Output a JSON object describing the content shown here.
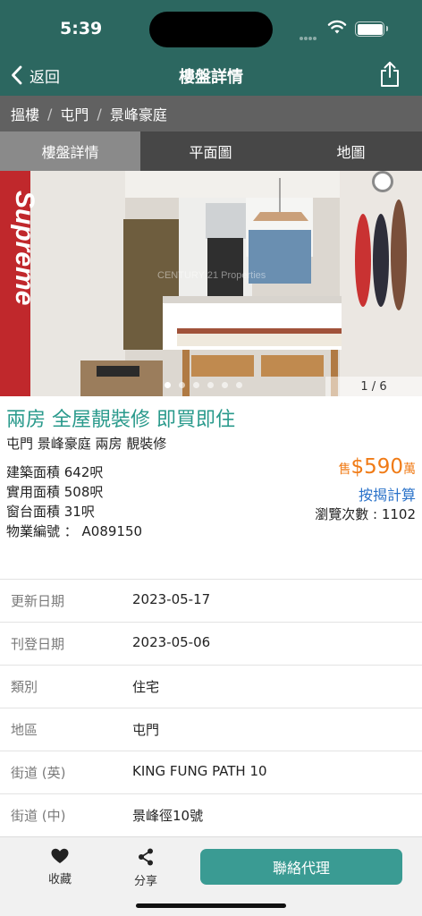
{
  "status_bar": {
    "time": "5:39"
  },
  "nav": {
    "back_label": "返回",
    "title": "樓盤詳情"
  },
  "breadcrumb": [
    "搵樓",
    "屯門",
    "景峰豪庭"
  ],
  "tabs": [
    "樓盤詳情",
    "平面圖",
    "地圖"
  ],
  "gallery": {
    "counter": "1 / 6",
    "banner_text": "Supreme",
    "watermark": "CENTURY 21 Properties",
    "current_index": 1,
    "total": 6
  },
  "listing": {
    "headline": "兩房 全屋靚裝修 即買即住",
    "subline": "屯門  景峰豪庭 兩房 靚裝修",
    "gross_area": "建築面積 642呎",
    "saleable_area": "實用面積 508呎",
    "bay_window_area": "窗台面積 31呎",
    "property_no": "物業編號 ： A089150",
    "price_label": "售",
    "price": "$590",
    "price_unit": "萬",
    "mortgage_link": "按揭計算",
    "views": "瀏覽次數 : 1102"
  },
  "details": [
    {
      "label": "更新日期",
      "value": "2023-05-17"
    },
    {
      "label": "刊登日期",
      "value": "2023-05-06"
    },
    {
      "label": "類別",
      "value": "住宅"
    },
    {
      "label": "地區",
      "value": "屯門"
    },
    {
      "label": "街道 (英)",
      "value": "KING FUNG PATH 10"
    },
    {
      "label": "街道 (中)",
      "value": "景峰徑10號"
    }
  ],
  "bottom_bar": {
    "favorite_label": "收藏",
    "share_label": "分享",
    "contact_label": "聯絡代理"
  },
  "colors": {
    "header": "#2c6760",
    "accent": "#2a9a8c",
    "price": "#f07b16",
    "link": "#2a72c9",
    "contact_button": "#3a9b93"
  },
  "icons": [
    "chevron-left-icon",
    "share-icon",
    "wifi-icon",
    "battery-icon",
    "heart-icon",
    "share-nodes-icon"
  ]
}
